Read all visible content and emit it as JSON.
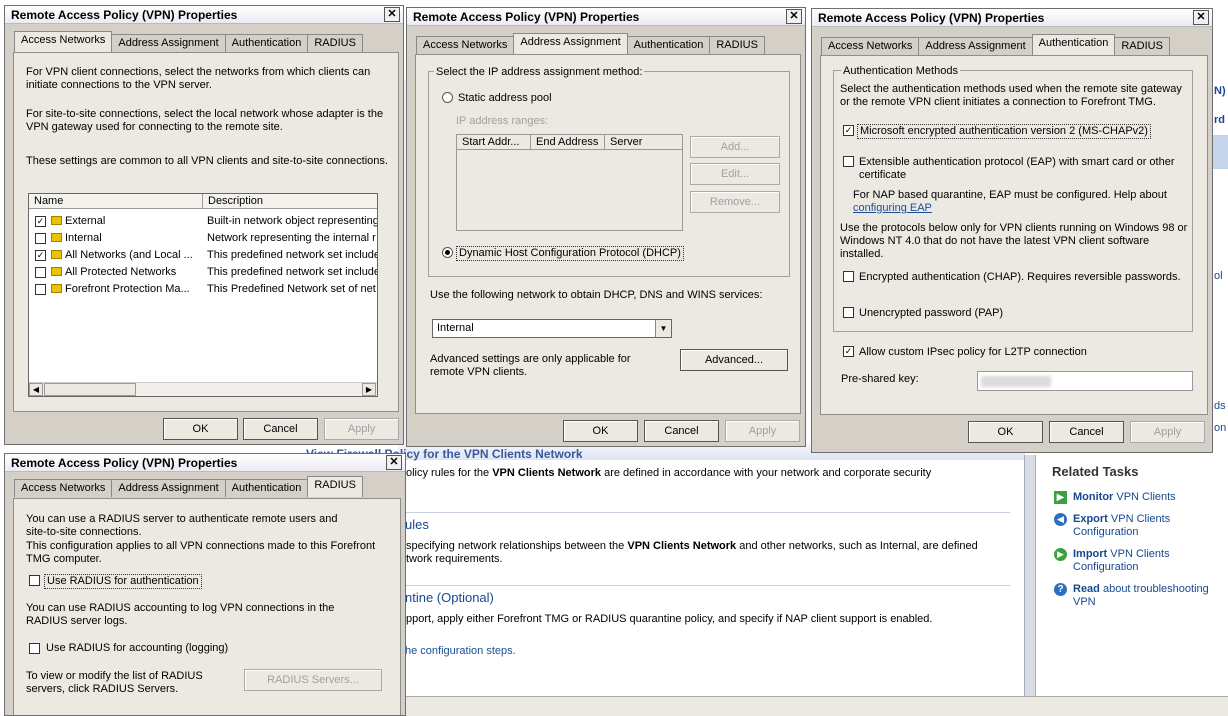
{
  "background": {
    "partial_title": "View Firewall Policy for the VPN Clients Network",
    "p1_pre": "olicy rules for the ",
    "p1_bold": "VPN Clients Network",
    "p1_post": " are defined in accordance with your network and corporate security",
    "rules_heading": "ules",
    "p2_pre": "specifying network relationships between the ",
    "p2_bold": "VPN Clients Network",
    "p2_post": " and other networks, such as Internal, are defined",
    "p2_line2": "twork requirements.",
    "quarantine_heading": "ntine (Optional)",
    "p3": "pport, apply either Forefront TMG or RADIUS quarantine policy, and specify if NAP client support is enabled.",
    "steps_link": "he configuration steps.",
    "right_frag1": "N)",
    "right_frag2": "rd",
    "right_frag3": "ol",
    "right_frag4": "ds",
    "right_frag5": "on",
    "related_tasks_title": "Related Tasks",
    "tasks": [
      {
        "bold": "Monitor",
        "text": " VPN Clients",
        "line2": ""
      },
      {
        "bold": "Export",
        "text": " VPN Clients",
        "line2": "Configuration"
      },
      {
        "bold": "Import",
        "text": " VPN Clients",
        "line2": "Configuration"
      },
      {
        "bold": "Read",
        "text": " about troubleshooting",
        "line2": "VPN"
      }
    ]
  },
  "dialog_title": "Remote Access Policy (VPN) Properties",
  "tabs": [
    "Access Networks",
    "Address Assignment",
    "Authentication",
    "RADIUS"
  ],
  "buttons": {
    "ok": "OK",
    "cancel": "Cancel",
    "apply": "Apply"
  },
  "access_networks": {
    "desc1": "For VPN client connections, select the networks from which clients can initiate connections to the VPN server.",
    "desc2": "For site-to-site connections, select the local network whose adapter is the VPN gateway used for connecting to the remote site.",
    "desc3": "These settings are common to all VPN clients and site-to-site connections.",
    "col_name": "Name",
    "col_desc": "Description",
    "rows": [
      {
        "checked": true,
        "name": "External",
        "desc": "Built-in network object representing"
      },
      {
        "checked": false,
        "name": "Internal",
        "desc": "Network representing the internal r"
      },
      {
        "checked": true,
        "name": "All Networks (and Local ...",
        "desc": "This predefined network set include"
      },
      {
        "checked": false,
        "name": "All Protected Networks",
        "desc": "This predefined network set include"
      },
      {
        "checked": false,
        "name": "Forefront Protection Ma...",
        "desc": "This Predefined Network set of net"
      }
    ]
  },
  "address_assignment": {
    "group_label": "Select the IP address assignment method:",
    "static_label": "Static address pool",
    "ip_ranges_label": "IP address ranges:",
    "cols": [
      "Start Addr...",
      "End Address",
      "Server"
    ],
    "add": "Add...",
    "edit": "Edit...",
    "remove": "Remove...",
    "dhcp_label": "Dynamic Host Configuration Protocol (DHCP)",
    "use_network_label": "Use the following network to obtain DHCP, DNS and WINS services:",
    "network_value": "Internal",
    "advanced_note": "Advanced settings are only applicable for remote VPN clients.",
    "advanced_button": "Advanced..."
  },
  "authentication": {
    "group_label": "Authentication Methods",
    "intro": "Select the authentication methods used when the remote site gateway or the remote VPN client initiates a connection to Forefront TMG.",
    "mschap": "Microsoft encrypted authentication version 2 (MS-CHAPv2)",
    "eap": "Extensible authentication protocol (EAP) with smart card or other certificate",
    "nap_note": "For NAP based quarantine, EAP must be configured. Help about",
    "nap_link": "configuring EAP",
    "legacy_note": "Use the protocols below only for VPN clients running on Windows 98 or Windows NT 4.0 that do not have the latest VPN client software installed.",
    "chap": "Encrypted authentication (CHAP). Requires reversible passwords.",
    "pap": "Unencrypted password (PAP)",
    "ipsec": "Allow custom IPsec policy for L2TP connection",
    "preshared_label": "Pre-shared key:"
  },
  "radius": {
    "desc1": "You can use a RADIUS server to authenticate remote users and site-to-site connections.",
    "desc2": "This configuration applies to all VPN connections made to this Forefront TMG computer.",
    "use_auth": "Use RADIUS for authentication",
    "desc3": "You can use RADIUS accounting to log VPN connections in the RADIUS server logs.",
    "use_acct": "Use RADIUS for accounting (logging)",
    "desc4": "To view or modify the list of RADIUS servers, click RADIUS Servers.",
    "servers_button": "RADIUS Servers..."
  }
}
